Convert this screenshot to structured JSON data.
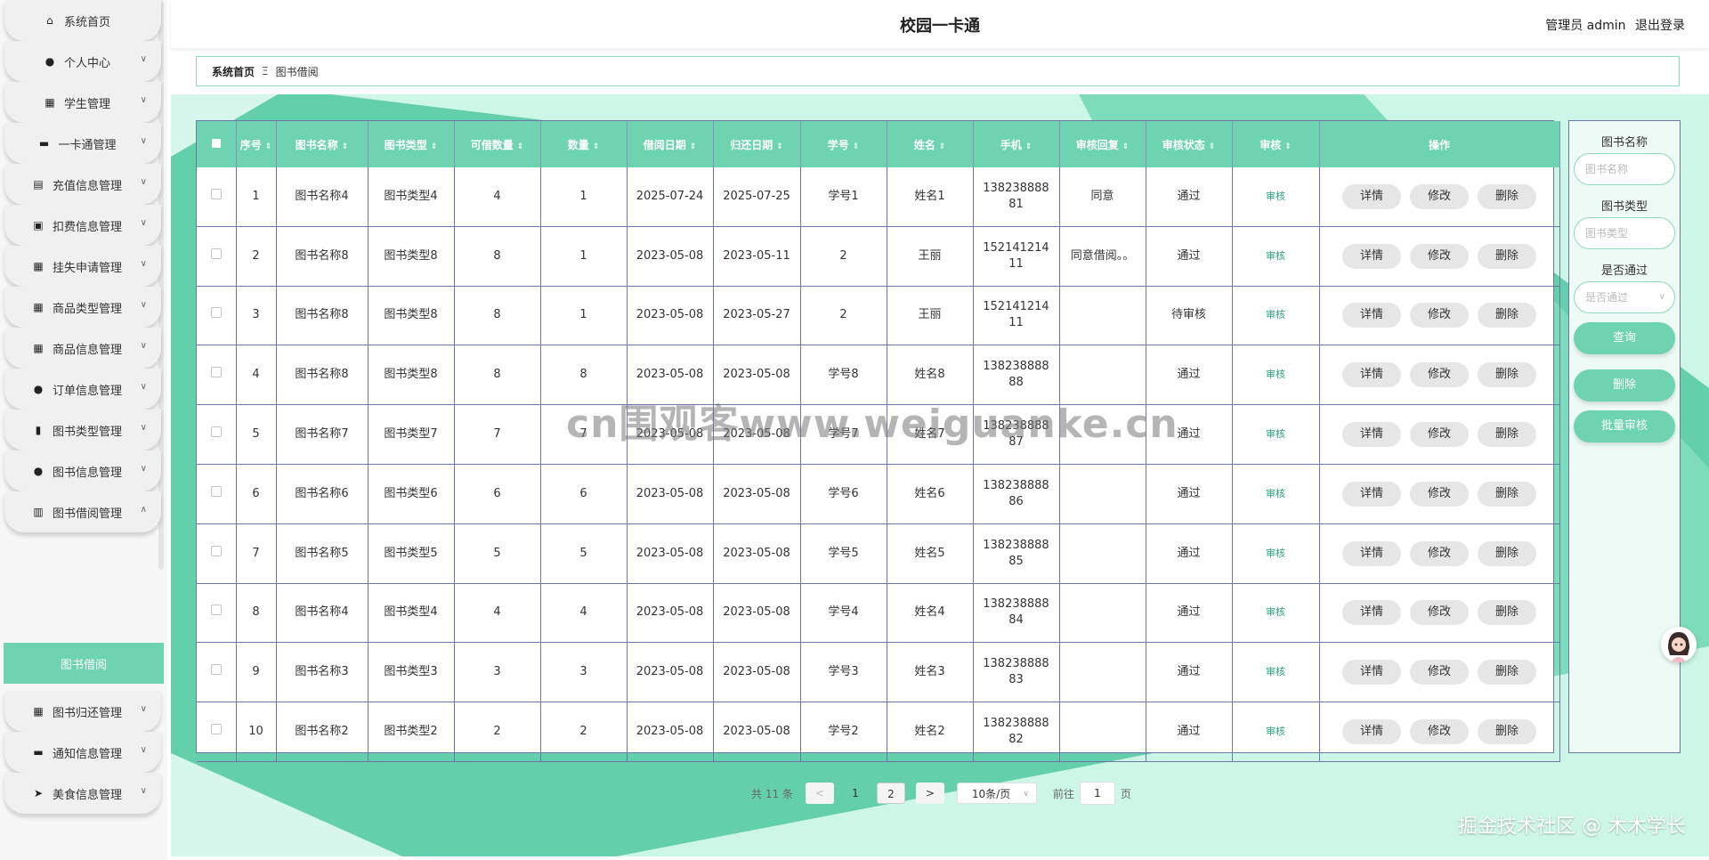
{
  "app": {
    "title": "校园一卡通"
  },
  "user": {
    "role": "管理员 admin",
    "logout": "退出登录"
  },
  "sidebar": {
    "items": [
      {
        "label": "系统首页",
        "icon": "home-icon"
      },
      {
        "label": "个人中心",
        "icon": "user-icon"
      },
      {
        "label": "学生管理",
        "icon": "grid-icon"
      },
      {
        "label": "一卡通管理",
        "icon": "monitor-icon"
      },
      {
        "label": "充值信息管理",
        "icon": "clipboard-icon"
      },
      {
        "label": "扣费信息管理",
        "icon": "clipboard-check-icon"
      },
      {
        "label": "挂失申请管理",
        "icon": "grid-icon"
      },
      {
        "label": "商品类型管理",
        "icon": "grid-icon"
      },
      {
        "label": "商品信息管理",
        "icon": "grid-icon"
      },
      {
        "label": "订单信息管理",
        "icon": "user-icon"
      },
      {
        "label": "图书类型管理",
        "icon": "bar-chart-icon"
      },
      {
        "label": "图书信息管理",
        "icon": "pin-icon"
      },
      {
        "label": "图书借阅管理",
        "icon": "book-icon"
      },
      {
        "label": "图书归还管理",
        "icon": "grid-icon"
      },
      {
        "label": "通知信息管理",
        "icon": "signboard-icon"
      },
      {
        "label": "美食信息管理",
        "icon": "send-icon"
      }
    ],
    "active_sub": "图书借阅"
  },
  "breadcrumb": {
    "home": "系统首页",
    "sep": "Ξ",
    "current": "图书借阅"
  },
  "table": {
    "columns": [
      "序号",
      "图书名称",
      "图书类型",
      "可借数量",
      "数量",
      "借阅日期",
      "归还日期",
      "学号",
      "姓名",
      "手机",
      "审核回复",
      "审核状态",
      "审核",
      "操作"
    ],
    "rows": [
      {
        "no": "1",
        "name": "图书名称4",
        "type": "图书类型4",
        "avail": "4",
        "qty": "1",
        "borrow": "2025-07-24",
        "return": "2025-07-25",
        "sid": "学号1",
        "sname": "姓名1",
        "phone": "13823888881",
        "reply": "同意",
        "status": "通过"
      },
      {
        "no": "2",
        "name": "图书名称8",
        "type": "图书类型8",
        "avail": "8",
        "qty": "1",
        "borrow": "2023-05-08",
        "return": "2023-05-11",
        "sid": "2",
        "sname": "王丽",
        "phone": "15214121411",
        "reply": "同意借阅。。",
        "status": "通过"
      },
      {
        "no": "3",
        "name": "图书名称8",
        "type": "图书类型8",
        "avail": "8",
        "qty": "1",
        "borrow": "2023-05-08",
        "return": "2023-05-27",
        "sid": "2",
        "sname": "王丽",
        "phone": "15214121411",
        "reply": "",
        "status": "待审核"
      },
      {
        "no": "4",
        "name": "图书名称8",
        "type": "图书类型8",
        "avail": "8",
        "qty": "8",
        "borrow": "2023-05-08",
        "return": "2023-05-08",
        "sid": "学号8",
        "sname": "姓名8",
        "phone": "13823888888",
        "reply": "",
        "status": "通过"
      },
      {
        "no": "5",
        "name": "图书名称7",
        "type": "图书类型7",
        "avail": "7",
        "qty": "7",
        "borrow": "2023-05-08",
        "return": "2023-05-08",
        "sid": "学号7",
        "sname": "姓名7",
        "phone": "13823888887",
        "reply": "",
        "status": "通过"
      },
      {
        "no": "6",
        "name": "图书名称6",
        "type": "图书类型6",
        "avail": "6",
        "qty": "6",
        "borrow": "2023-05-08",
        "return": "2023-05-08",
        "sid": "学号6",
        "sname": "姓名6",
        "phone": "13823888886",
        "reply": "",
        "status": "通过"
      },
      {
        "no": "7",
        "name": "图书名称5",
        "type": "图书类型5",
        "avail": "5",
        "qty": "5",
        "borrow": "2023-05-08",
        "return": "2023-05-08",
        "sid": "学号5",
        "sname": "姓名5",
        "phone": "13823888885",
        "reply": "",
        "status": "通过"
      },
      {
        "no": "8",
        "name": "图书名称4",
        "type": "图书类型4",
        "avail": "4",
        "qty": "4",
        "borrow": "2023-05-08",
        "return": "2023-05-08",
        "sid": "学号4",
        "sname": "姓名4",
        "phone": "13823888884",
        "reply": "",
        "status": "通过"
      },
      {
        "no": "9",
        "name": "图书名称3",
        "type": "图书类型3",
        "avail": "3",
        "qty": "3",
        "borrow": "2023-05-08",
        "return": "2023-05-08",
        "sid": "学号3",
        "sname": "姓名3",
        "phone": "13823888883",
        "reply": "",
        "status": "通过"
      },
      {
        "no": "10",
        "name": "图书名称2",
        "type": "图书类型2",
        "avail": "2",
        "qty": "2",
        "borrow": "2023-05-08",
        "return": "2023-05-08",
        "sid": "学号2",
        "sname": "姓名2",
        "phone": "13823888882",
        "reply": "",
        "status": "通过"
      }
    ],
    "audit_label": "审核",
    "actions": [
      "详情",
      "修改",
      "删除"
    ]
  },
  "search": {
    "name_label": "图书名称",
    "name_placeholder": "图书名称",
    "type_label": "图书类型",
    "type_placeholder": "图书类型",
    "pass_label": "是否通过",
    "pass_placeholder": "是否通过",
    "query": "查询",
    "delete": "删除",
    "batch_audit": "批量审核"
  },
  "pager": {
    "total": "共 11 条",
    "prev": "<",
    "pages": [
      "1",
      "2"
    ],
    "next": ">",
    "size": "10条/页",
    "goto": "前往",
    "goto_value": "1",
    "page_unit": "页"
  },
  "watermarks": {
    "center": "cn围观客www.weiguanke.cn",
    "footer": "掘金技术社区 @ 木木学长"
  },
  "colors": {
    "accent": "#6dd3b0",
    "border": "#6e76a8"
  }
}
